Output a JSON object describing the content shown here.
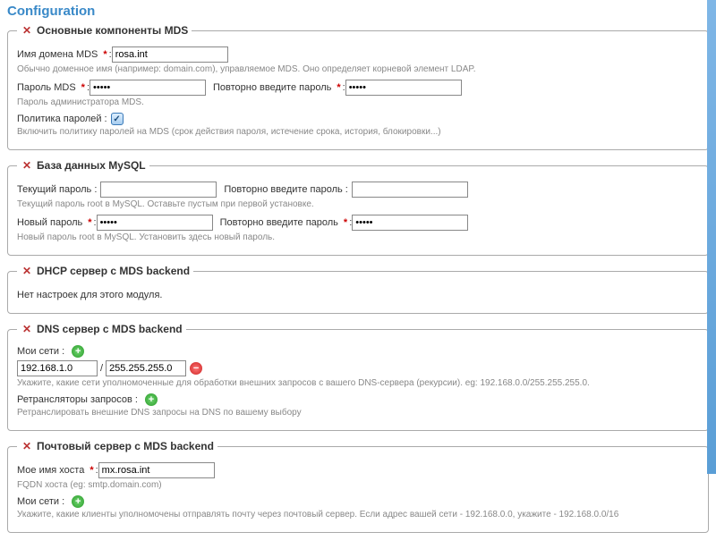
{
  "page_title": "Configuration",
  "sections": {
    "mds": {
      "title": "Основные компоненты MDS",
      "domain_label": "Имя домена MDS",
      "domain_value": "rosa.int",
      "domain_desc": "Обычно доменное имя (например: domain.com), управляемое MDS. Оно определяет корневой элемент LDAP.",
      "pass_label": "Пароль MDS",
      "pass_value": "•••••",
      "repass_label": "Повторно введите пароль",
      "repass_value": "•••••",
      "pass_desc": "Пароль администратора MDS.",
      "policy_label": "Политика паролей :",
      "policy_desc": "Включить политику паролей на MDS (срок действия пароля, истечение срока, история, блокировки...)"
    },
    "mysql": {
      "title": "База данных MySQL",
      "cur_label": "Текущий пароль :",
      "cur_value": "",
      "cur_re_label": "Повторно введите пароль :",
      "cur_re_value": "",
      "cur_desc": "Текущий пароль root в MySQL. Оставьте пустым при первой установке.",
      "new_label": "Новый пароль",
      "new_value": "•••••",
      "new_re_label": "Повторно введите пароль",
      "new_re_value": "•••••",
      "new_desc": "Новый пароль root в MySQL. Установить здесь новый пароль."
    },
    "dhcp": {
      "title": "DHCP сервер с MDS backend",
      "empty": "Нет настроек для этого модуля."
    },
    "dns": {
      "title": "DNS сервер с MDS backend",
      "net_label": "Мои сети :",
      "net_ip": "192.168.1.0",
      "net_mask": "255.255.255.0",
      "net_desc": "Укажите, какие сети уполномоченные для обработки внешних запросов с вашего DNS-сервера (рекурсии). eg: 192.168.0.0/255.255.255.0.",
      "fwd_label": "Ретрансляторы запросов :",
      "fwd_desc": "Ретранслировать внешние DNS запросы на DNS по вашему выбору"
    },
    "mail": {
      "title": "Почтовый сервер с MDS backend",
      "host_label": "Мое имя хоста",
      "host_value": "mx.rosa.int",
      "host_desc": "FQDN хоста (eg: smtp.domain.com)",
      "net_label": "Мои сети :",
      "net_desc": "Укажите, какие клиенты уполномочены отправлять почту через почтовый сервер. Если адрес вашей сети - 192.168.0.0, укажите - 192.168.0.0/16"
    }
  },
  "colon": " :"
}
